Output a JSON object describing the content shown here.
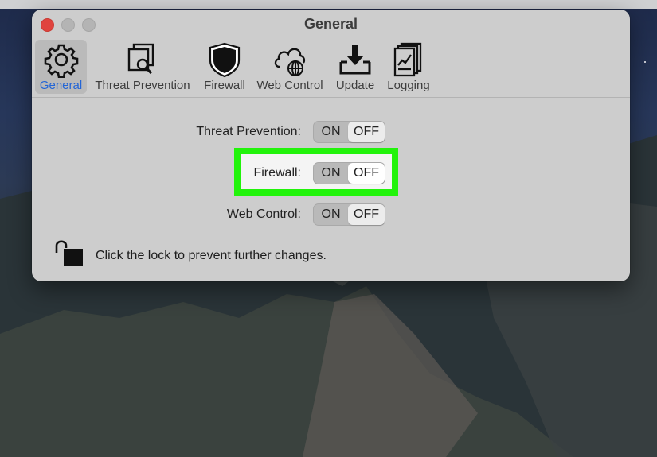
{
  "window": {
    "title": "General"
  },
  "toolbar": {
    "items": [
      {
        "label": "General",
        "icon": "gear-icon",
        "selected": true
      },
      {
        "label": "Threat Prevention",
        "icon": "threat-scan-icon",
        "selected": false
      },
      {
        "label": "Firewall",
        "icon": "shield-icon",
        "selected": false
      },
      {
        "label": "Web Control",
        "icon": "cloud-globe-icon",
        "selected": false
      },
      {
        "label": "Update",
        "icon": "download-icon",
        "selected": false
      },
      {
        "label": "Logging",
        "icon": "log-chart-icon",
        "selected": false
      }
    ]
  },
  "settings": {
    "rows": [
      {
        "label": "Threat Prevention:",
        "on": "ON",
        "off": "OFF",
        "selected": "OFF"
      },
      {
        "label": "Firewall:",
        "on": "ON",
        "off": "OFF",
        "selected": "OFF"
      },
      {
        "label": "Web Control:",
        "on": "ON",
        "off": "OFF",
        "selected": "OFF"
      }
    ]
  },
  "lock": {
    "icon": "unlocked-padlock-icon",
    "text": "Click the lock to prevent further changes."
  },
  "colors": {
    "highlight": "#22f30b",
    "selected_tab": "#2365d6",
    "close_button": "#e0443e"
  }
}
